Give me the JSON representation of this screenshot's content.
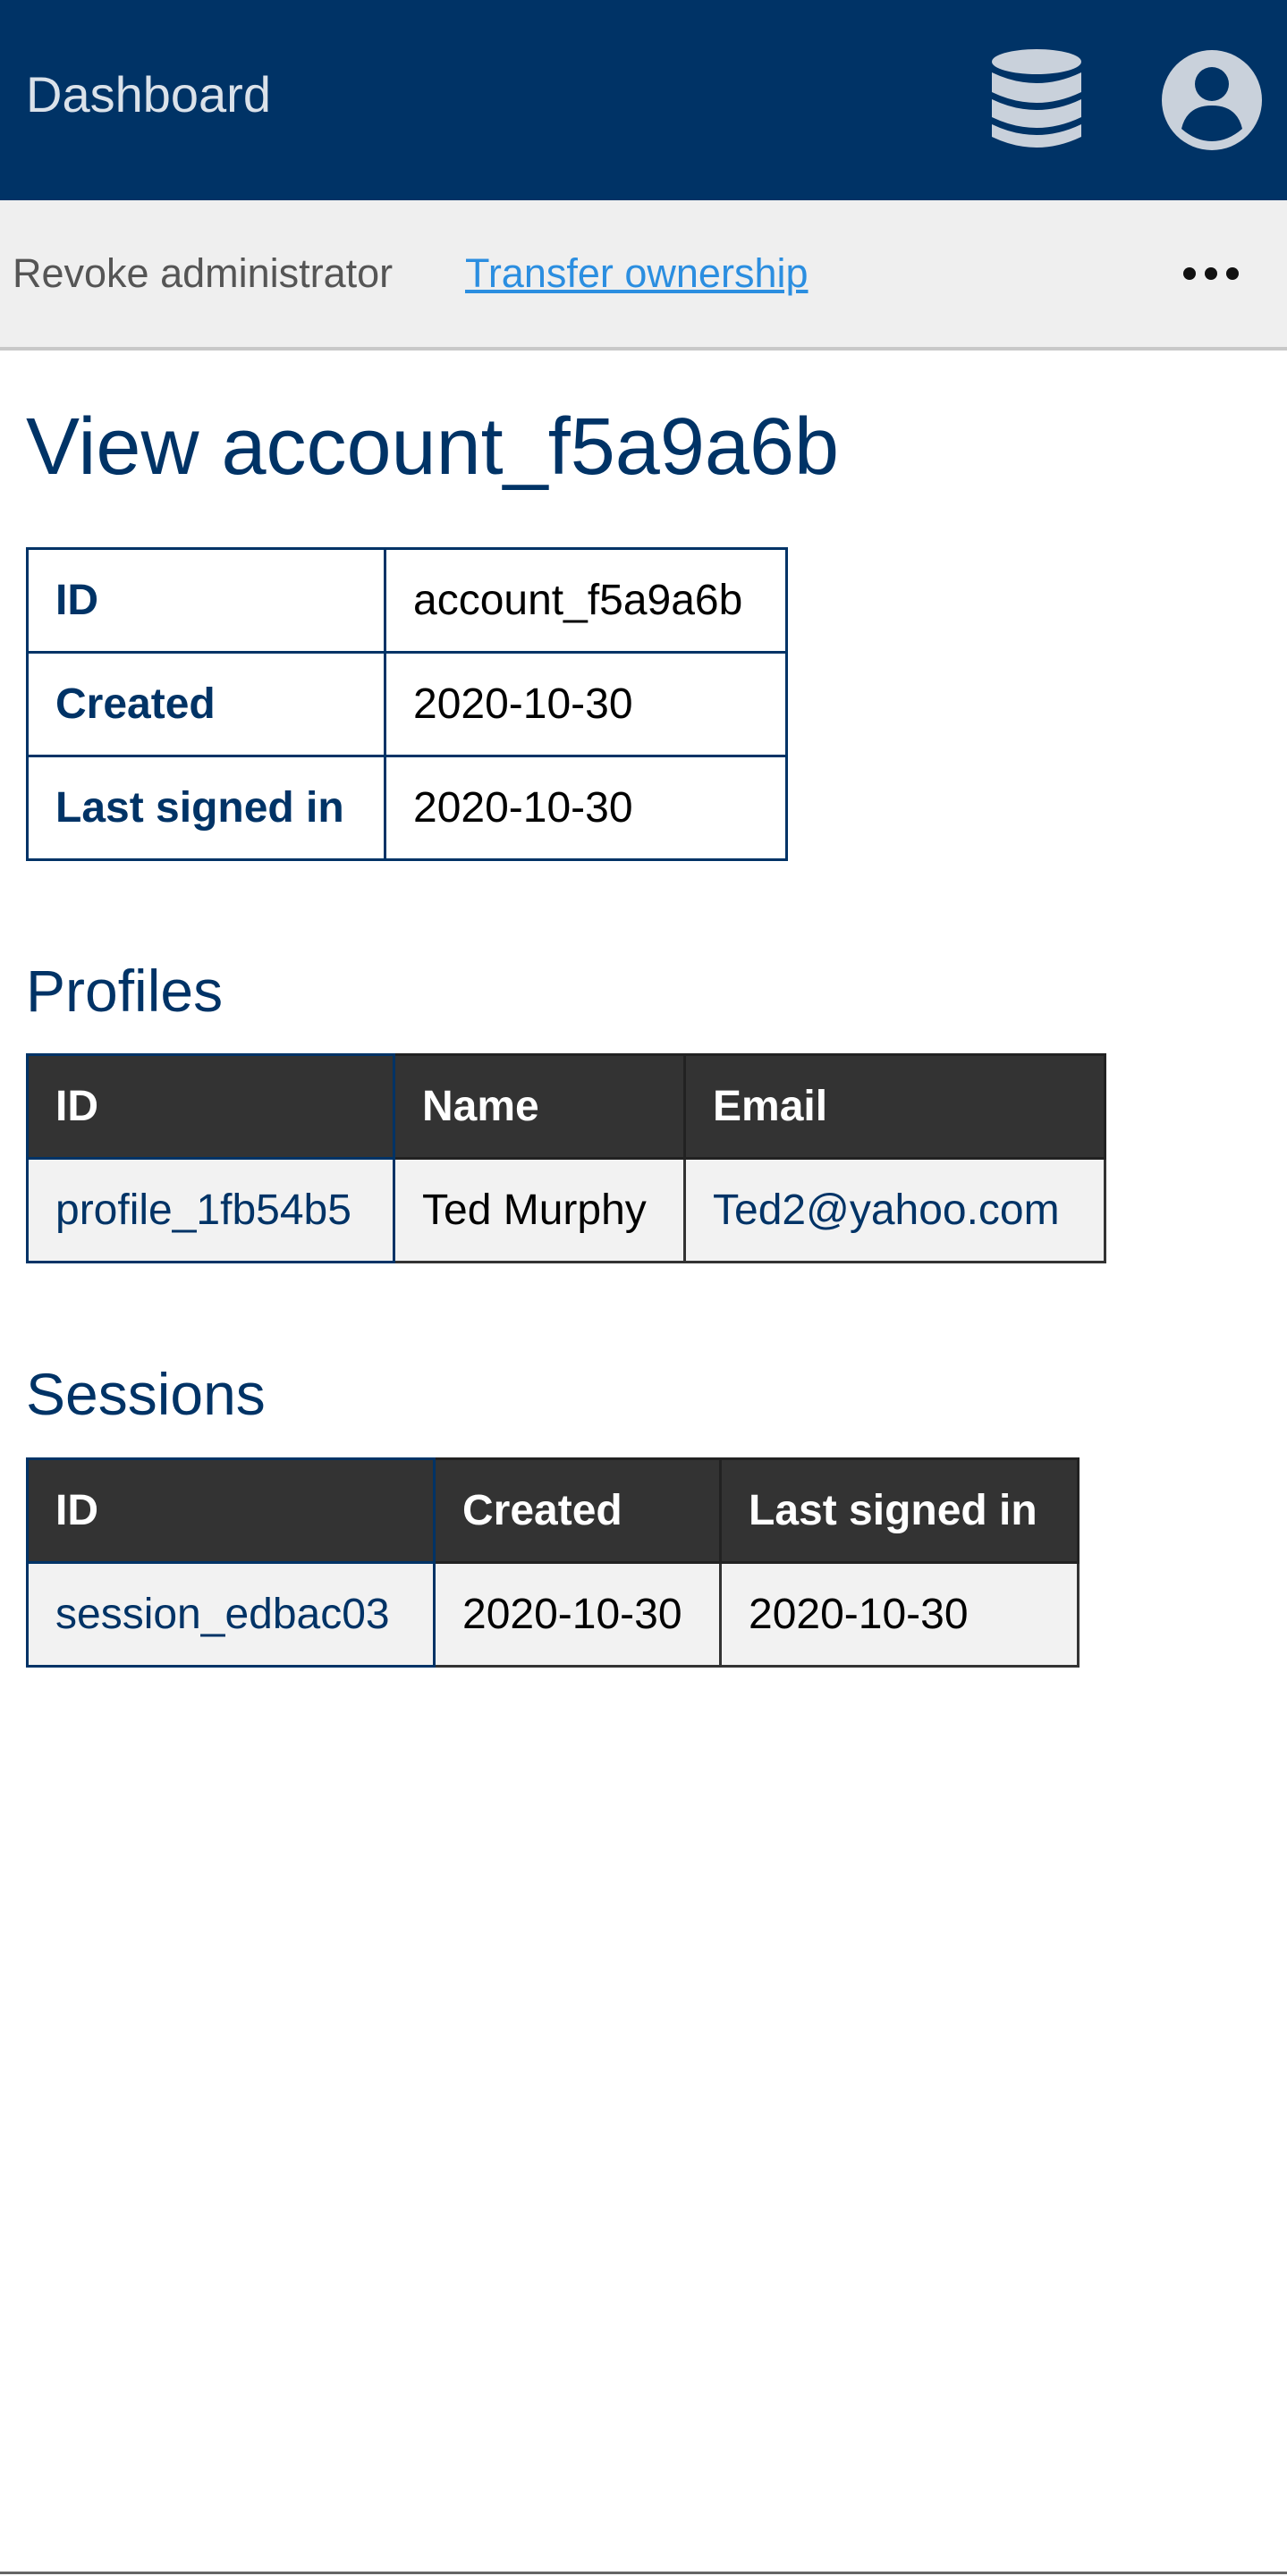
{
  "header": {
    "title": "Dashboard",
    "icons": [
      "database-icon",
      "user-avatar-icon"
    ],
    "background": "#003366"
  },
  "actions": {
    "revoke_label": "Revoke administrator",
    "transfer_label": "Transfer ownership",
    "more_icon": "more-dots-icon"
  },
  "page": {
    "title": "View account_f5a9a6b"
  },
  "account": {
    "rows": [
      {
        "key": "ID",
        "value": "account_f5a9a6b"
      },
      {
        "key": "Created",
        "value": "2020-10-30"
      },
      {
        "key": "Last signed in",
        "value": "2020-10-30"
      }
    ]
  },
  "profiles": {
    "heading": "Profiles",
    "columns": [
      "ID",
      "Name",
      "Email"
    ],
    "rows": [
      {
        "id": "profile_1fb54b5",
        "name": "Ted Murphy",
        "email": "Ted2@yahoo.com"
      }
    ]
  },
  "sessions": {
    "heading": "Sessions",
    "columns": [
      "ID",
      "Created",
      "Last signed in"
    ],
    "rows": [
      {
        "id": "session_edbac03",
        "created": "2020-10-30",
        "last_signed_in": "2020-10-30"
      }
    ]
  },
  "colors": {
    "brand": "#003366",
    "link": "#2b8ee0",
    "table_header": "#333333"
  }
}
